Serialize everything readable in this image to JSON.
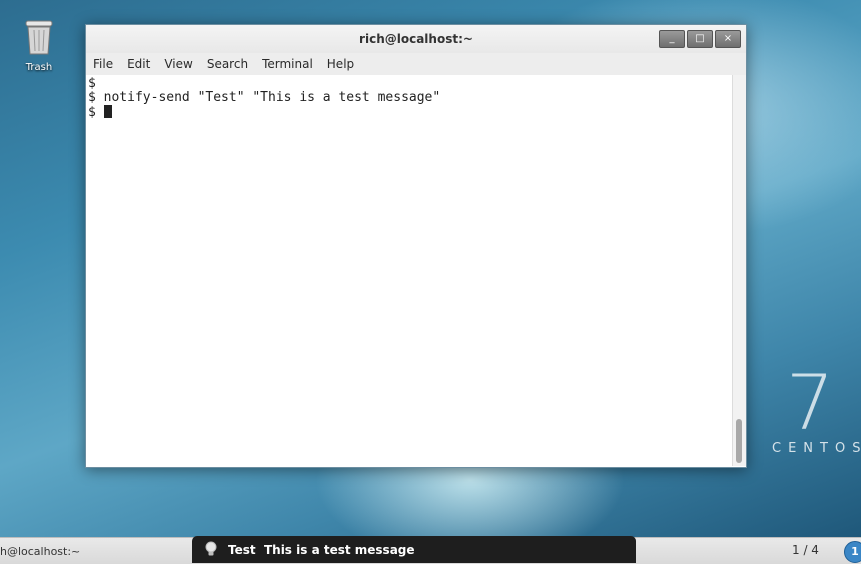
{
  "desktop": {
    "trash_label": "Trash",
    "brand_number": "7",
    "brand_name": "CENTOS"
  },
  "window": {
    "title": "rich@localhost:~",
    "controls": {
      "minimize": "_",
      "maximize": "□",
      "close": "×"
    },
    "menu": [
      "File",
      "Edit",
      "View",
      "Search",
      "Terminal",
      "Help"
    ]
  },
  "terminal": {
    "lines": [
      "$",
      "$ notify-send \"Test\" \"This is a test message\"",
      "$"
    ]
  },
  "taskbar": {
    "task_label": "h@localhost:~",
    "pager": "1 / 4",
    "tray_badge": "1"
  },
  "notification": {
    "title": "Test",
    "body": "This is a test message",
    "icon": "lightbulb-icon"
  },
  "colors": {
    "terminal_bg": "#ffffff",
    "notification_bg": "#1e1e1e",
    "tray_badge": "#3a86c6"
  }
}
